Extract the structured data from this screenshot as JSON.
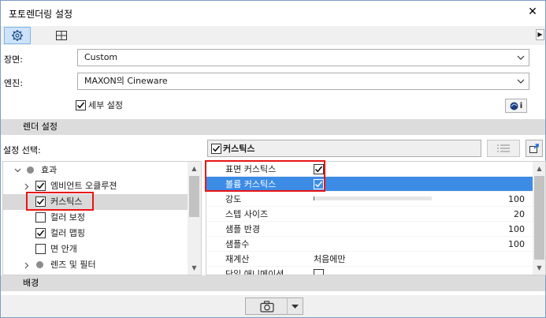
{
  "window": {
    "title": "포토렌더링 설정",
    "close_glyph": "✕"
  },
  "toolbar": {
    "settings_icon": "gear-icon",
    "view_icon": "grid-icon"
  },
  "scene": {
    "label": "장면:",
    "value": "Custom"
  },
  "engine": {
    "label": "엔진:",
    "value": "MAXON의 Cineware"
  },
  "detail": {
    "label": "세부 설정",
    "checked": true
  },
  "render_settings": {
    "header": "렌더 설정",
    "select_label": "설정 선택:"
  },
  "tree": {
    "items": [
      {
        "label": "효과",
        "checked": null
      },
      {
        "label": "엠비언트 오클루젼",
        "checked": true
      },
      {
        "label": "커스틱스",
        "checked": true
      },
      {
        "label": "컬러 보정",
        "checked": false
      },
      {
        "label": "컬러 맵핑",
        "checked": true
      },
      {
        "label": "면 안개",
        "checked": false
      },
      {
        "label": "렌즈 및 필터",
        "checked": null
      }
    ]
  },
  "props": {
    "header": "커스틱스",
    "rows": [
      {
        "label": "표면 커스틱스",
        "value": ""
      },
      {
        "label": "볼륨 커스틱스",
        "value": ""
      },
      {
        "label": "강도",
        "value": "100"
      },
      {
        "label": "스텝 사이즈",
        "value": "20"
      },
      {
        "label": "샘플 반경",
        "value": "100"
      },
      {
        "label": "샘플수",
        "value": "100"
      },
      {
        "label": "재계산",
        "value": "처음에만"
      },
      {
        "label": "단일 애니메이션 ...",
        "value": ""
      }
    ],
    "strength_fraction": 0.0
  },
  "background_section": {
    "header": "배경"
  },
  "colors": {
    "highlight": "#3c8ce6",
    "annotation": "#e81515",
    "section_bg": "#dcdcdc"
  }
}
